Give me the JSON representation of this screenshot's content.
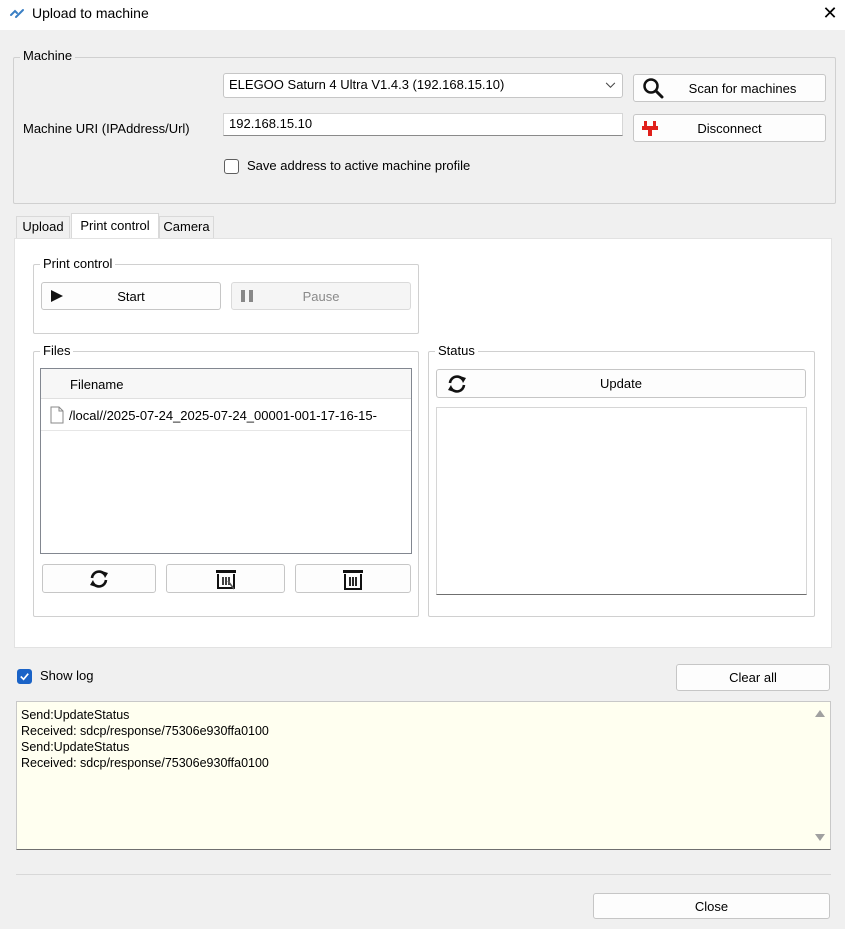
{
  "window": {
    "title": "Upload to machine",
    "close_glyph": "✕"
  },
  "machine": {
    "legend": "Machine",
    "selected_machine": "ELEGOO Saturn 4 Ultra V1.4.3 (192.168.15.10)",
    "uri_label": "Machine URI (IPAddress/Url)",
    "uri_value": "192.168.15.10",
    "save_label": "Save address to active machine profile",
    "save_checked": false,
    "scan_label": "Scan for machines",
    "disconnect_label": "Disconnect"
  },
  "tabs": [
    {
      "label": "Upload"
    },
    {
      "label": "Print control",
      "active": true
    },
    {
      "label": "Camera"
    }
  ],
  "print_control": {
    "legend": "Print control",
    "start_label": "Start",
    "pause_label": "Pause",
    "pause_enabled": false
  },
  "files": {
    "legend": "Files",
    "column_header": "Filename",
    "rows": [
      {
        "name": "/local//2025-07-24_2025-07-24_00001-001-17-16-15-"
      }
    ]
  },
  "status": {
    "legend": "Status",
    "update_label": "Update"
  },
  "log": {
    "show_label": "Show log",
    "show_checked": true,
    "clear_label": "Clear all",
    "lines": [
      "Send:UpdateStatus",
      "Received: sdcp/response/75306e930ffa0100",
      "Send:UpdateStatus",
      "Received: sdcp/response/75306e930ffa0100"
    ]
  },
  "footer": {
    "close_label": "Close"
  },
  "colors": {
    "accent": "#1a63c7",
    "disconnect_icon": "#e0201b",
    "log_background": "#fffff0"
  },
  "icons": {
    "app": "link-icon",
    "scan": "search-icon",
    "disconnect": "plug-icon",
    "start": "play-icon",
    "pause": "pause-icon",
    "refresh": "refresh-icon",
    "download": "download-icon",
    "delete": "trash-icon",
    "file": "file-icon"
  }
}
